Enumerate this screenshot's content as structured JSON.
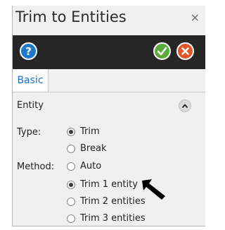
{
  "window": {
    "title": "Trim to Entities",
    "close_icon": "×"
  },
  "toolbar": {
    "help_icon": "help-icon",
    "ok_icon": "check-icon",
    "cancel_icon": "cancel-icon",
    "colors": {
      "help": "#1e78c8",
      "ok": "#5aaa3c",
      "cancel": "#e0552a"
    }
  },
  "tabs": [
    {
      "label": "Basic",
      "active": true
    }
  ],
  "section": {
    "title": "Entity",
    "type": {
      "label": "Type:",
      "options": [
        {
          "label": "Trim",
          "checked": true
        },
        {
          "label": "Break",
          "checked": false
        }
      ]
    },
    "method": {
      "label": "Method:",
      "options": [
        {
          "label": "Auto",
          "checked": false
        },
        {
          "label": "Trim 1 entity",
          "checked": true
        },
        {
          "label": "Trim 2 entities",
          "checked": false
        },
        {
          "label": "Trim 3 entities",
          "checked": false
        }
      ]
    }
  }
}
